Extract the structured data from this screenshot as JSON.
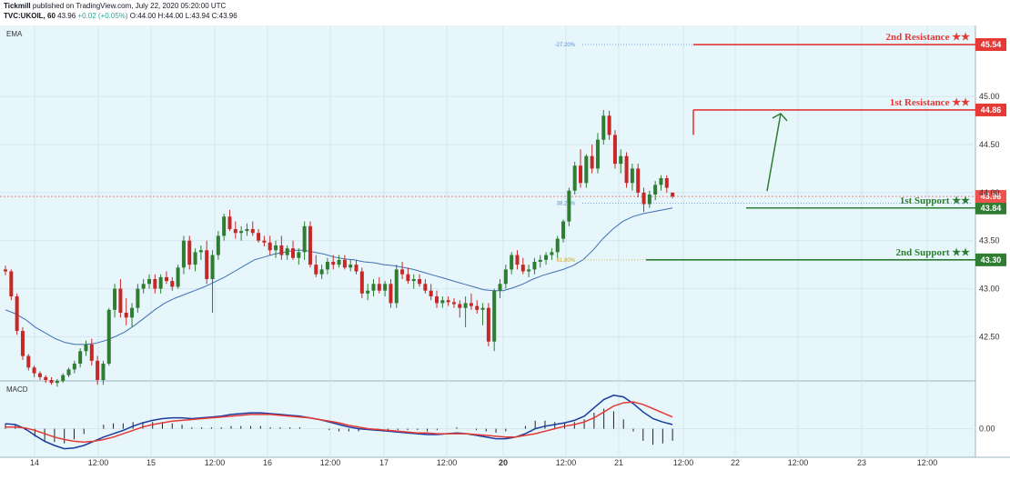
{
  "header": {
    "publisher": "Tickmill",
    "published_text": "published on TradingView.com, July 22, 2020 05:20:00 UTC",
    "symbol": "TVC:UKOIL, 60",
    "last": "43.96",
    "change": "+0.02 (+0.05%)",
    "ohlc": "O:44.00 H:44.00 L:43.94 C:43.96"
  },
  "colors": {
    "background": "#e7f6fb",
    "bull": "#2e7d32",
    "bear": "#c62828",
    "ema": "#3f6fb5",
    "resistance": "#e53935",
    "support": "#2e7d32",
    "macd": "#1a3c9e",
    "signal": "#e53935"
  },
  "chart_data": [
    {
      "type": "candlestick",
      "pane": "price",
      "indicator_label": "EMA",
      "timeframe": "60",
      "x_tick_labels": [
        "14",
        "12:00",
        "15",
        "12:00",
        "16",
        "12:00",
        "17",
        "12:00",
        "20",
        "12:00",
        "21",
        "12:00",
        "22",
        "12:00",
        "23",
        "12:00"
      ],
      "y_tick_labels": [
        "42.50",
        "43.00",
        "43.50",
        "44.00",
        "44.50",
        "45.00"
      ],
      "ylim": [
        42.05,
        45.72
      ],
      "candles_ohlc": [
        [
          43.2,
          43.24,
          43.14,
          43.18
        ],
        [
          43.18,
          43.2,
          42.88,
          42.92
        ],
        [
          42.92,
          42.95,
          42.52,
          42.56
        ],
        [
          42.56,
          42.6,
          42.26,
          42.3
        ],
        [
          42.3,
          42.32,
          42.15,
          42.18
        ],
        [
          42.18,
          42.2,
          42.08,
          42.12
        ],
        [
          42.12,
          42.14,
          42.05,
          42.08
        ],
        [
          42.08,
          42.1,
          42.02,
          42.05
        ],
        [
          42.05,
          42.08,
          42.0,
          42.02
        ],
        [
          42.02,
          42.06,
          41.98,
          42.04
        ],
        [
          42.04,
          42.12,
          42.02,
          42.1
        ],
        [
          42.1,
          42.18,
          42.08,
          42.16
        ],
        [
          42.16,
          42.25,
          42.12,
          42.22
        ],
        [
          42.22,
          42.38,
          42.18,
          42.35
        ],
        [
          42.35,
          42.46,
          42.3,
          42.42
        ],
        [
          42.42,
          42.48,
          42.2,
          42.25
        ],
        [
          42.25,
          42.3,
          42.0,
          42.05
        ],
        [
          42.05,
          42.25,
          42.0,
          42.22
        ],
        [
          42.22,
          42.8,
          42.2,
          42.78
        ],
        [
          42.78,
          43.05,
          42.7,
          43.0
        ],
        [
          43.0,
          43.1,
          42.7,
          42.75
        ],
        [
          42.75,
          42.9,
          42.62,
          42.7
        ],
        [
          42.7,
          42.85,
          42.6,
          42.8
        ],
        [
          42.8,
          43.05,
          42.75,
          43.0
        ],
        [
          43.0,
          43.1,
          42.95,
          43.05
        ],
        [
          43.05,
          43.15,
          43.0,
          43.1
        ],
        [
          43.1,
          43.15,
          42.95,
          43.0
        ],
        [
          43.0,
          43.15,
          42.95,
          43.12
        ],
        [
          43.12,
          43.18,
          43.05,
          43.08
        ],
        [
          43.08,
          43.12,
          42.98,
          43.02
        ],
        [
          43.02,
          43.25,
          43.0,
          43.22
        ],
        [
          43.22,
          43.55,
          43.15,
          43.5
        ],
        [
          43.5,
          43.55,
          43.2,
          43.25
        ],
        [
          43.25,
          43.42,
          43.18,
          43.38
        ],
        [
          43.38,
          43.45,
          43.3,
          43.4
        ],
        [
          43.4,
          43.5,
          43.05,
          43.1
        ],
        [
          43.1,
          43.4,
          42.75,
          43.35
        ],
        [
          43.35,
          43.6,
          43.3,
          43.55
        ],
        [
          43.55,
          43.78,
          43.5,
          43.75
        ],
        [
          43.75,
          43.82,
          43.6,
          43.62
        ],
        [
          43.62,
          43.7,
          43.52,
          43.58
        ],
        [
          43.58,
          43.65,
          43.5,
          43.6
        ],
        [
          43.6,
          43.68,
          43.55,
          43.62
        ],
        [
          43.62,
          43.7,
          43.55,
          43.58
        ],
        [
          43.58,
          43.62,
          43.48,
          43.5
        ],
        [
          43.5,
          43.55,
          43.44,
          43.48
        ],
        [
          43.48,
          43.55,
          43.35,
          43.4
        ],
        [
          43.4,
          43.5,
          43.32,
          43.45
        ],
        [
          43.45,
          43.55,
          43.3,
          43.35
        ],
        [
          43.35,
          43.45,
          43.3,
          43.42
        ],
        [
          43.42,
          43.5,
          43.3,
          43.32
        ],
        [
          43.32,
          43.42,
          43.25,
          43.38
        ],
        [
          43.38,
          43.7,
          43.3,
          43.65
        ],
        [
          43.65,
          43.7,
          43.22,
          43.25
        ],
        [
          43.25,
          43.35,
          43.12,
          43.15
        ],
        [
          43.15,
          43.25,
          43.1,
          43.2
        ],
        [
          43.2,
          43.32,
          43.15,
          43.28
        ],
        [
          43.28,
          43.35,
          43.2,
          43.25
        ],
        [
          43.25,
          43.35,
          43.22,
          43.3
        ],
        [
          43.3,
          43.35,
          43.2,
          43.22
        ],
        [
          43.22,
          43.3,
          43.18,
          43.25
        ],
        [
          43.25,
          43.3,
          43.15,
          43.18
        ],
        [
          43.18,
          43.22,
          42.9,
          42.95
        ],
        [
          42.95,
          43.05,
          42.88,
          42.98
        ],
        [
          42.98,
          43.1,
          42.92,
          43.05
        ],
        [
          43.05,
          43.12,
          42.95,
          42.98
        ],
        [
          42.98,
          43.08,
          42.92,
          43.05
        ],
        [
          43.05,
          43.1,
          42.8,
          42.85
        ],
        [
          42.85,
          43.25,
          42.8,
          43.2
        ],
        [
          43.2,
          43.28,
          43.1,
          43.15
        ],
        [
          43.15,
          43.22,
          43.05,
          43.08
        ],
        [
          43.08,
          43.15,
          43.0,
          43.1
        ],
        [
          43.1,
          43.15,
          43.02,
          43.05
        ],
        [
          43.05,
          43.1,
          42.95,
          42.98
        ],
        [
          42.98,
          43.05,
          42.88,
          42.92
        ],
        [
          42.92,
          42.98,
          42.8,
          42.85
        ],
        [
          42.85,
          42.92,
          42.8,
          42.88
        ],
        [
          42.88,
          42.92,
          42.82,
          42.86
        ],
        [
          42.86,
          42.9,
          42.8,
          42.84
        ],
        [
          42.84,
          42.88,
          42.7,
          42.8
        ],
        [
          42.8,
          42.92,
          42.6,
          42.85
        ],
        [
          42.85,
          42.95,
          42.78,
          42.82
        ],
        [
          42.82,
          42.88,
          42.74,
          42.78
        ],
        [
          42.78,
          42.85,
          42.62,
          42.8
        ],
        [
          42.8,
          42.85,
          42.4,
          42.45
        ],
        [
          42.45,
          43.0,
          42.35,
          42.98
        ],
        [
          42.98,
          43.1,
          42.9,
          43.05
        ],
        [
          43.05,
          43.25,
          43.0,
          43.2
        ],
        [
          43.2,
          43.38,
          43.15,
          43.35
        ],
        [
          43.35,
          43.4,
          43.2,
          43.25
        ],
        [
          43.25,
          43.32,
          43.15,
          43.18
        ],
        [
          43.18,
          43.25,
          43.12,
          43.2
        ],
        [
          43.2,
          43.32,
          43.15,
          43.28
        ],
        [
          43.28,
          43.35,
          43.22,
          43.3
        ],
        [
          43.3,
          43.38,
          43.25,
          43.35
        ],
        [
          43.35,
          43.42,
          43.3,
          43.38
        ],
        [
          43.38,
          43.55,
          43.32,
          43.52
        ],
        [
          43.52,
          43.72,
          43.48,
          43.7
        ],
        [
          43.7,
          44.05,
          43.65,
          44.02
        ],
        [
          44.02,
          44.32,
          43.98,
          44.28
        ],
        [
          44.28,
          44.45,
          44.05,
          44.1
        ],
        [
          44.1,
          44.4,
          44.05,
          44.38
        ],
        [
          44.38,
          44.5,
          44.2,
          44.25
        ],
        [
          44.25,
          44.62,
          44.2,
          44.55
        ],
        [
          44.55,
          44.86,
          44.5,
          44.8
        ],
        [
          44.8,
          44.85,
          44.55,
          44.6
        ],
        [
          44.6,
          44.65,
          44.25,
          44.3
        ],
        [
          44.3,
          44.45,
          44.2,
          44.38
        ],
        [
          44.38,
          44.42,
          44.05,
          44.1
        ],
        [
          44.1,
          44.3,
          44.02,
          44.25
        ],
        [
          44.25,
          44.3,
          43.95,
          44.0
        ],
        [
          44.0,
          44.05,
          43.8,
          43.88
        ],
        [
          43.88,
          44.02,
          43.84,
          43.98
        ],
        [
          43.98,
          44.12,
          43.92,
          44.08
        ],
        [
          44.08,
          44.18,
          44.02,
          44.15
        ],
        [
          44.15,
          44.18,
          44.0,
          44.05
        ],
        [
          44.0,
          44.0,
          43.94,
          43.96
        ]
      ],
      "ema_series": [
        42.78,
        42.74,
        42.68,
        42.6,
        42.54,
        42.48,
        42.44,
        42.42,
        42.42,
        42.43,
        42.46,
        42.5,
        42.55,
        42.62,
        42.7,
        42.78,
        42.85,
        42.9,
        42.94,
        42.98,
        43.02,
        43.07,
        43.12,
        43.18,
        43.24,
        43.3,
        43.33,
        43.36,
        43.38,
        43.4,
        43.4,
        43.38,
        43.36,
        43.33,
        43.31,
        43.3,
        43.28,
        43.27,
        43.25,
        43.24,
        43.22,
        43.2,
        43.17,
        43.14,
        43.11,
        43.08,
        43.05,
        43.02,
        42.99,
        42.98,
        42.98,
        43.01,
        43.05,
        43.1,
        43.14,
        43.17,
        43.2,
        43.24,
        43.3,
        43.4,
        43.52,
        43.62,
        43.7,
        43.75,
        43.78,
        43.8,
        43.82,
        43.84
      ],
      "levels": [
        {
          "label": "2nd Resistance ★★",
          "value": "45.54",
          "kind": "resistance"
        },
        {
          "label": "1st Resistance ★★",
          "value": "44.86",
          "kind": "resistance"
        },
        {
          "label": "1st Support ★★",
          "value": "43.84",
          "kind": "support"
        },
        {
          "label": "2nd Support ★★",
          "value": "43.30",
          "kind": "support"
        }
      ],
      "fib_levels": [
        {
          "label": "-27.20%",
          "value": 45.54
        },
        {
          "label": "38.20%",
          "value": 43.89
        },
        {
          "label": "61.80%",
          "value": 43.3
        }
      ],
      "last_price": {
        "value": 43.96,
        "label": "43.96"
      },
      "arrow": {
        "from": 43.96,
        "to": 44.86
      }
    },
    {
      "type": "line",
      "pane": "macd",
      "indicator_label": "MACD",
      "y_tick_labels": [
        "0.00"
      ],
      "ylim": [
        -0.32,
        0.55
      ],
      "series": [
        {
          "values": [
            0.06,
            0.05,
            0.0,
            -0.08,
            -0.15,
            -0.2,
            -0.24,
            -0.23,
            -0.2,
            -0.15,
            -0.1,
            -0.06,
            -0.02,
            0.03,
            0.07,
            0.1,
            0.12,
            0.13,
            0.13,
            0.12,
            0.13,
            0.14,
            0.15,
            0.17,
            0.18,
            0.19,
            0.19,
            0.18,
            0.17,
            0.16,
            0.15,
            0.13,
            0.11,
            0.08,
            0.05,
            0.02,
            0.0,
            -0.01,
            -0.02,
            -0.03,
            -0.04,
            -0.05,
            -0.06,
            -0.07,
            -0.07,
            -0.06,
            -0.05,
            -0.06,
            -0.08,
            -0.1,
            -0.12,
            -0.12,
            -0.1,
            -0.06,
            0.0,
            0.03,
            0.05,
            0.07,
            0.1,
            0.15,
            0.25,
            0.35,
            0.4,
            0.38,
            0.3,
            0.2,
            0.12,
            0.08,
            0.05
          ]
        },
        {
          "values": [
            0.02,
            0.02,
            0.01,
            -0.02,
            -0.06,
            -0.1,
            -0.13,
            -0.15,
            -0.16,
            -0.15,
            -0.13,
            -0.1,
            -0.06,
            -0.02,
            0.02,
            0.05,
            0.07,
            0.09,
            0.1,
            0.11,
            0.12,
            0.13,
            0.14,
            0.15,
            0.16,
            0.17,
            0.17,
            0.17,
            0.16,
            0.15,
            0.14,
            0.13,
            0.11,
            0.09,
            0.07,
            0.04,
            0.02,
            0.0,
            -0.01,
            -0.02,
            -0.03,
            -0.04,
            -0.05,
            -0.05,
            -0.06,
            -0.06,
            -0.06,
            -0.06,
            -0.07,
            -0.08,
            -0.09,
            -0.1,
            -0.1,
            -0.08,
            -0.06,
            -0.03,
            0.0,
            0.03,
            0.05,
            0.08,
            0.13,
            0.2,
            0.27,
            0.31,
            0.32,
            0.29,
            0.24,
            0.19,
            0.14
          ]
        }
      ]
    }
  ]
}
